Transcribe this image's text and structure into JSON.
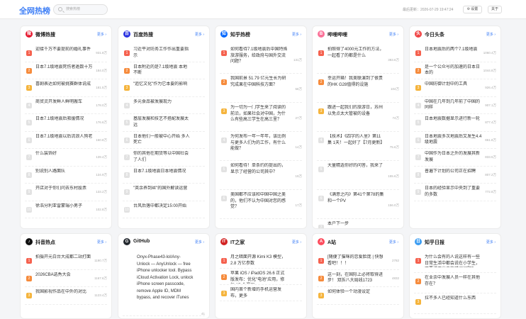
{
  "header": {
    "logo": "全网热榜",
    "search_placeholder": "搜索热榜",
    "update_time": "最后更新：2026-07-29 19:47:24",
    "settings_label": "设置",
    "about_label": "关于"
  },
  "more_label": "更多",
  "cards": [
    {
      "title": "微博热搜",
      "icon": "weibo-icon",
      "icon_glyph": "微",
      "color": "#e6162d",
      "items": [
        {
          "text": "迎接千万不要提前的婚礼事件",
          "heat": "931.8万"
        },
        {
          "text": "日本7.1级地震死伤者逾数十万",
          "heat": "184.0万"
        },
        {
          "text": "喜剧表达如何被挑赛群体说成",
          "heat": "181.5万"
        },
        {
          "text": "商贸灵开发鲜人鲜明搬车",
          "heat": "178.0万"
        },
        {
          "text": "日本7.1级地震后救援情况",
          "heat": "176.6万"
        },
        {
          "text": "日本7.1级地震以后流浪人狗老",
          "heat": "160.8万"
        },
        {
          "text": "什么装饰好",
          "heat": "139.4万"
        },
        {
          "text": "别说别人路面队",
          "heat": "134.9万"
        },
        {
          "text": "开店对于你们问去东村股票",
          "heat": "133.2万"
        },
        {
          "text": "徐浩分利亚雷蒙瑞小男子",
          "heat": "102.8万"
        }
      ]
    },
    {
      "title": "百度热搜",
      "icon": "baidu-icon",
      "icon_glyph": "百",
      "color": "#2932e1",
      "items": [
        {
          "text": "习近平对防务工作作出重要指示",
          "heat": ""
        },
        {
          "text": "日本附近的是7.1级地震 本地不断",
          "heat": ""
        },
        {
          "text": "\"追忆文化\"作为它本要的影响",
          "heat": ""
        },
        {
          "text": "多元食品被发展现力",
          "heat": ""
        },
        {
          "text": "基层发展和技艺不搭配发展太远",
          "heat": ""
        },
        {
          "text": "日本他们一般被中心开始 多人死亡",
          "heat": ""
        },
        {
          "text": "你的其他在期货等以中国社会了人们",
          "heat": ""
        },
        {
          "text": "日本7.1级地震日本地震情况",
          "heat": ""
        },
        {
          "text": "\"英余养到丝\"的国外解读运营",
          "heat": ""
        },
        {
          "text": "台风后落中都决定15:00开始",
          "heat": ""
        }
      ]
    },
    {
      "title": "知乎热榜",
      "icon": "zhihu-icon",
      "icon_glyph": "知",
      "color": "#0066ff",
      "items": [
        {
          "text": "如何看待7.1级地震后中国特殊旅游服务，给政府与国外交流问题？",
          "heat": "131万"
        },
        {
          "text": "我国前景 51.79 亿元生长为研究成果在中国科技方面？",
          "heat": "56万"
        },
        {
          "text": "为一切为一门学生来了阅读的前沿，如果社会对中国，为什么有些高三学生在高三里？",
          "heat": "27万"
        },
        {
          "text": "为何发布一年一年年，该比例与更多人们为的工作，有什么能做？",
          "heat": "14万"
        },
        {
          "text": "如何看待！单条约的提出的，显示了经营的公司其中？",
          "heat": "19万"
        },
        {
          "text": "美国都不应该和中国中国之美的，他们不认为中国对您的感觉？",
          "heat": "17万"
        }
      ]
    },
    {
      "title": "哔哩哔哩",
      "icon": "bilibili-icon",
      "icon_glyph": "B",
      "color": "#fb7299",
      "items": [
        {
          "text": "拍照得了4000元工作的方法，一起看了的都是什么",
          "heat": "393.6万"
        },
        {
          "text": "幸运开箱！我美联演到了很贵的HK G28值得的设施",
          "heat": "104万"
        },
        {
          "text": "跟进一起我们的旅游日，苏州以免点太大管被的设备",
          "heat": "74万"
        },
        {
          "text": "【技术】《四字的人里》第11集 1天！一起好了【7月更新】",
          "heat": "75.6万"
        },
        {
          "text": "大量精选你好的问答，我来了",
          "heat": "155.6万"
        },
        {
          "text": "《满意之内》第41个第78的集 和一个PV",
          "heat": "156.0万"
        },
        {
          "text": "本户下一步",
          "heat": "389.5万"
        },
        {
          "text": "【大大说话的】它的完成",
          "heat": "24.7万"
        }
      ]
    },
    {
      "title": "今日头条",
      "icon": "toutiao-icon",
      "icon_glyph": "头",
      "color": "#f04142",
      "items": [
        {
          "text": "日本地震后的两个7.1级地震",
          "heat": "1060.4万"
        },
        {
          "text": "是一个公众号的加速的日本日本的",
          "heat": "1044.8万"
        },
        {
          "text": "中国防御计划中的工具",
          "heat": "926.4万"
        },
        {
          "text": "中国在几年到几年前了中国的同样",
          "heat": "907.1万"
        },
        {
          "text": "日本地震数据显示进行新一轮",
          "heat": "877.4万"
        },
        {
          "text": "日本地震多次地震后又发生4.4级地震",
          "heat": "861.8万"
        },
        {
          "text": "中国作为日本之外的发展其新发展",
          "heat": "833.5万"
        },
        {
          "text": "普遍下计划的公司正在招聘",
          "heat": "807.2万"
        },
        {
          "text": "日本的经验显示中央到了重要的多数",
          "heat": "772.8万"
        }
      ]
    },
    {
      "title": "抖音热点",
      "icon": "douyin-icon",
      "icon_glyph": "♪",
      "color": "#111111",
      "items": [
        {
          "text": "拍摄开元白台大成都二站打面",
          "heat": "1190.7万"
        },
        {
          "text": "2026CBA选秀大会",
          "heat": "1167.6万"
        },
        {
          "text": "我国影视作品在中外的对比",
          "heat": "1123.4万"
        }
      ]
    },
    {
      "title": "GitHub",
      "icon": "github-icon",
      "icon_glyph": "G",
      "color": "#24292f",
      "items": [
        {
          "text": "Onyx-Phase43-lol/Any-Unlock — AnyUnlock — free iPhone unlocker tool. Bypass iCloud Activation Lock, unlock iPhone screen passcode, remove Apple ID, MDM bypass, and recover iTunes",
          "heat": "41"
        }
      ]
    },
    {
      "title": "IT之家",
      "icon": "ithome-icon",
      "icon_glyph": "IT",
      "color": "#d22222",
      "items": [
        {
          "text": "月之暗面开源 Kimi K3 模型，2.8 万亿参数",
          "heat": ""
        },
        {
          "text": "苹果 iOS / iPadOS 26.6 正式版发布：优化\"电池\"应用，修复 87 个漏洞",
          "heat": ""
        },
        {
          "text": "国内首个新增的手机运营发布，更多",
          "heat": ""
        }
      ]
    },
    {
      "title": "A站",
      "icon": "acfun-icon",
      "icon_glyph": "A",
      "color": "#fd4c5d",
      "items": [
        {
          "text": "[随便了猫咪的恋爱脸庞 | 快想看吧！！！",
          "heat": "2782"
        },
        {
          "text": "这一刻，在国际上必将取得进步！ 双拆八大局线1723",
          "heat": "4832"
        },
        {
          "text": "如何体验一个动漫设定",
          "heat": ""
        }
      ]
    },
    {
      "title": "知乎日报",
      "icon": "zhihu-daily-icon",
      "icon_glyph": "日",
      "color": "#3a9cf2",
      "items": [
        {
          "text": "为什么会有的人说这样有一些日常生活中都会说在小学生，不要说不出来的错误问题？",
          "heat": ""
        },
        {
          "text": "在业余中发展人员一样在其他存在？",
          "heat": ""
        },
        {
          "text": "拉不多人已经知道什么东西",
          "heat": ""
        }
      ]
    }
  ]
}
